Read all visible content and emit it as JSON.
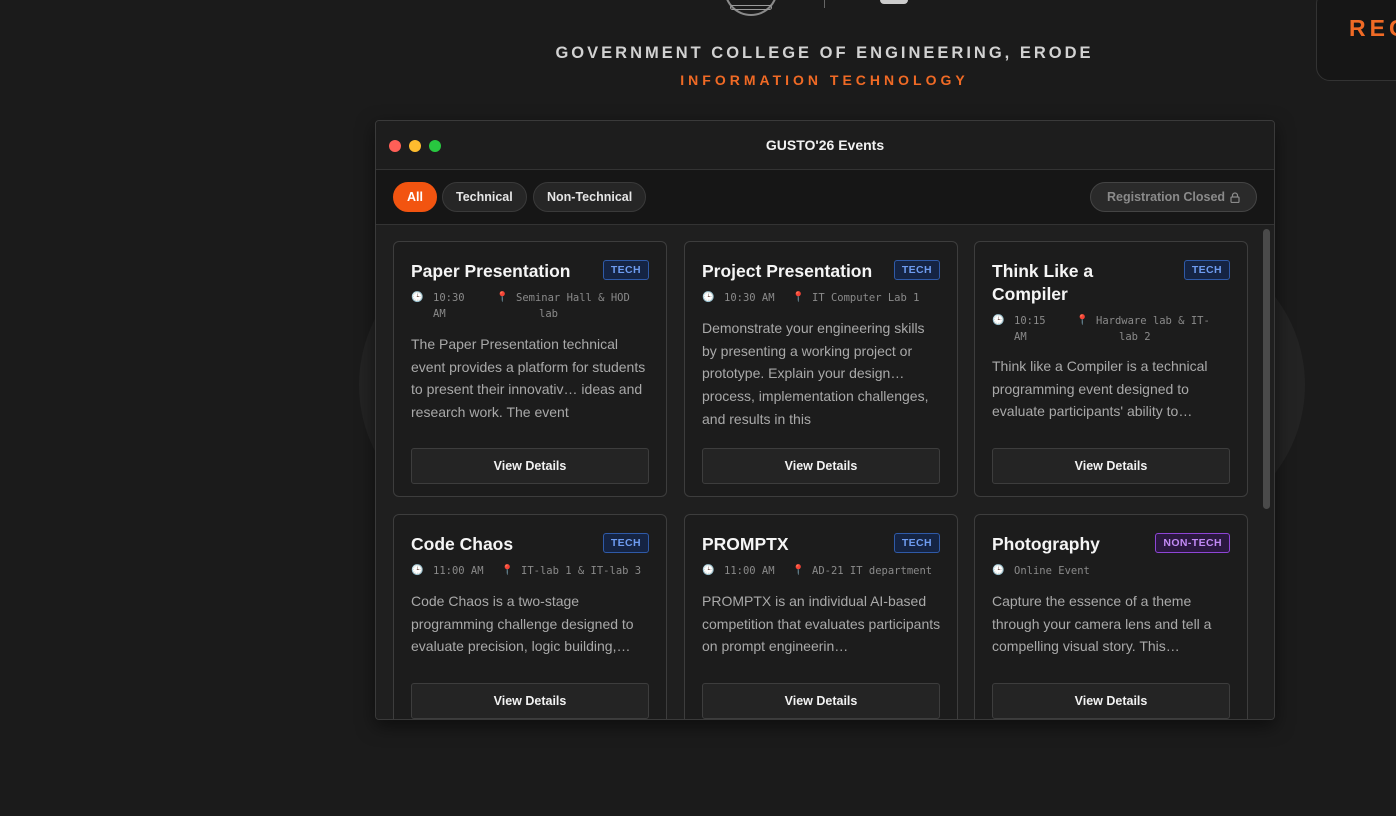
{
  "header": {
    "college": "GOVERNMENT COLLEGE OF ENGINEERING, ERODE",
    "department": "INFORMATION TECHNOLOGY",
    "register_label": "REG"
  },
  "window": {
    "title": "GUSTO'26 Events"
  },
  "filters": {
    "all": "All",
    "technical": "Technical",
    "non_technical": "Non-Technical",
    "status": "Registration Closed"
  },
  "events": [
    {
      "title": "Paper Presentation",
      "badge": "TECH",
      "time": "10:30\nAM",
      "location": "Seminar Hall & HOD\nlab",
      "description": "The Paper Presentation technical event provides a platform for students to present their innovativ… ideas and research work. The event",
      "button": "View Details"
    },
    {
      "title": "Project Presentation",
      "badge": "TECH",
      "time": "10:30 AM",
      "location": "IT Computer Lab 1",
      "description": "Demonstrate your engineering skills by presenting a working project or prototype. Explain your design… process, implementation challenges, and results in this",
      "button": "View Details"
    },
    {
      "title": "Think Like a Compiler",
      "badge": "TECH",
      "time": "10:15\nAM",
      "location": "Hardware lab & IT-\nlab 2",
      "description": "Think like a Compiler is a technical programming event designed to evaluate participants' ability to…",
      "button": "View Details"
    },
    {
      "title": "Code Chaos",
      "badge": "TECH",
      "time": "11:00 AM",
      "location": "IT-lab 1 & IT-lab 3",
      "description": "Code Chaos is a two-stage programming challenge designed to evaluate precision, logic building,…",
      "button": "View Details"
    },
    {
      "title": "PROMPTX",
      "badge": "TECH",
      "time": "11:00 AM",
      "location": "AD-21 IT department",
      "description": "PROMPTX is an individual AI-based competition that evaluates participants on prompt engineerin…",
      "button": "View Details"
    },
    {
      "title": "Photography",
      "badge": "NON-TECH",
      "time": "Online Event",
      "location": "",
      "description": "Capture the essence of a theme through your camera lens and tell a compelling visual story. This…",
      "button": "View Details"
    }
  ]
}
